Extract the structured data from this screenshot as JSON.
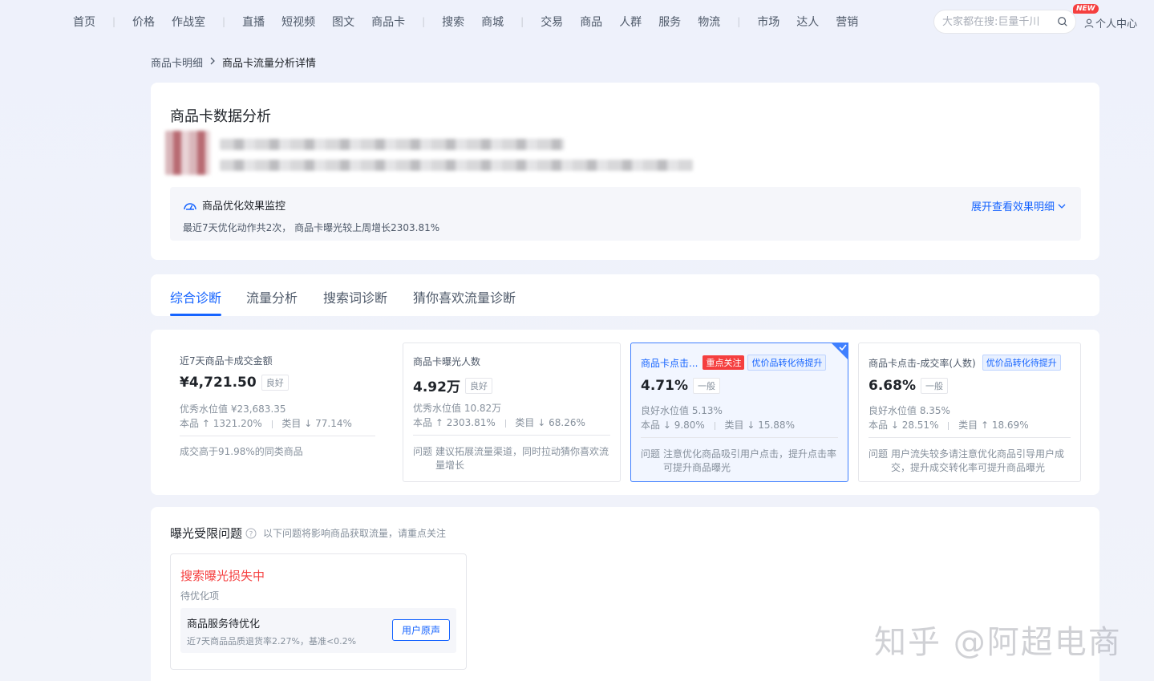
{
  "nav": {
    "items": [
      {
        "label": "首页"
      },
      {
        "sep": true
      },
      {
        "label": "价格"
      },
      {
        "label": "作战室"
      },
      {
        "sep": true
      },
      {
        "label": "直播"
      },
      {
        "label": "短视频"
      },
      {
        "label": "图文"
      },
      {
        "label": "商品卡"
      },
      {
        "sep": true
      },
      {
        "label": "搜索"
      },
      {
        "label": "商城"
      },
      {
        "sep": true
      },
      {
        "label": "交易"
      },
      {
        "label": "商品"
      },
      {
        "label": "人群"
      },
      {
        "label": "服务"
      },
      {
        "label": "物流"
      },
      {
        "sep": true
      },
      {
        "label": "市场"
      },
      {
        "label": "达人"
      },
      {
        "label": "营销"
      }
    ],
    "search_placeholder": "大家都在搜:巨量千川",
    "new_badge": "NEW",
    "user_center": "个人中心"
  },
  "breadcrumb": {
    "parent": "商品卡明细",
    "separator": ">",
    "current": "商品卡流量分析详情"
  },
  "header": {
    "title": "商品卡数据分析",
    "monitor": {
      "title": "商品优化效果监控",
      "desc": "最近7天优化动作共2次， 商品卡曝光较上周增长2303.81%",
      "expand": "展开查看效果明细"
    }
  },
  "tabs": [
    {
      "label": "综合诊断",
      "active": true
    },
    {
      "label": "流量分析"
    },
    {
      "label": "搜索词诊断"
    },
    {
      "label": "猜你喜欢流量诊断"
    }
  ],
  "metrics": [
    {
      "title": "近7天商品卡成交金额",
      "value": "¥4,721.50",
      "grade": "良好",
      "benchmark": "优秀水位值 ¥23,683.35",
      "self_label": "本品",
      "self_change": "↑ 1321.20%",
      "cat_label": "类目",
      "cat_change": "↓ 77.14%",
      "note": "成交高于91.98%的同类商品"
    },
    {
      "title": "商品卡曝光人数",
      "value": "4.92万",
      "grade": "良好",
      "benchmark": "优秀水位值 10.82万",
      "self_label": "本品",
      "self_change": "↑ 2303.81%",
      "cat_label": "类目",
      "cat_change": "↓ 68.26%",
      "note_label": "问题",
      "note": "建议拓展流量渠道，同时拉动猜你喜欢流量增长"
    },
    {
      "title": "商品卡点击...",
      "tag_red": "重点关注",
      "tag_blue": "优价品转化待提升",
      "value": "4.71%",
      "grade": "一般",
      "benchmark": "良好水位值 5.13%",
      "self_label": "本品",
      "self_change": "↓ 9.80%",
      "cat_label": "类目",
      "cat_change": "↓ 15.88%",
      "note_label": "问题",
      "note": "注意优化商品吸引用户点击，提升点击率可提升商品曝光"
    },
    {
      "title": "商品卡点击-成交率(人数)",
      "tag_blue": "优价品转化待提升",
      "value": "6.68%",
      "grade": "一般",
      "benchmark": "良好水位值 8.35%",
      "self_label": "本品",
      "self_change": "↓ 28.51%",
      "cat_label": "类目",
      "cat_change": "↑ 18.69%",
      "note_label": "问题",
      "note": "用户流失较多请注意优化商品引导用户成交，提升成交转化率可提升商品曝光"
    }
  ],
  "exposure": {
    "title": "曝光受限问题",
    "subtitle": "以下问题将影响商品获取流量，请重点关注",
    "issue": {
      "title": "搜索曝光损失中",
      "subtitle": "待优化项",
      "item_title": "商品服务待优化",
      "item_desc": "近7天商品品质退货率2.27%，基准<0.2%",
      "button": "用户原声"
    }
  },
  "watermark": "知乎 @阿超电商",
  "colors": {
    "accent": "#1664ff",
    "danger": "#f53f3f",
    "text": "#1f2329",
    "muted": "#86909c"
  }
}
